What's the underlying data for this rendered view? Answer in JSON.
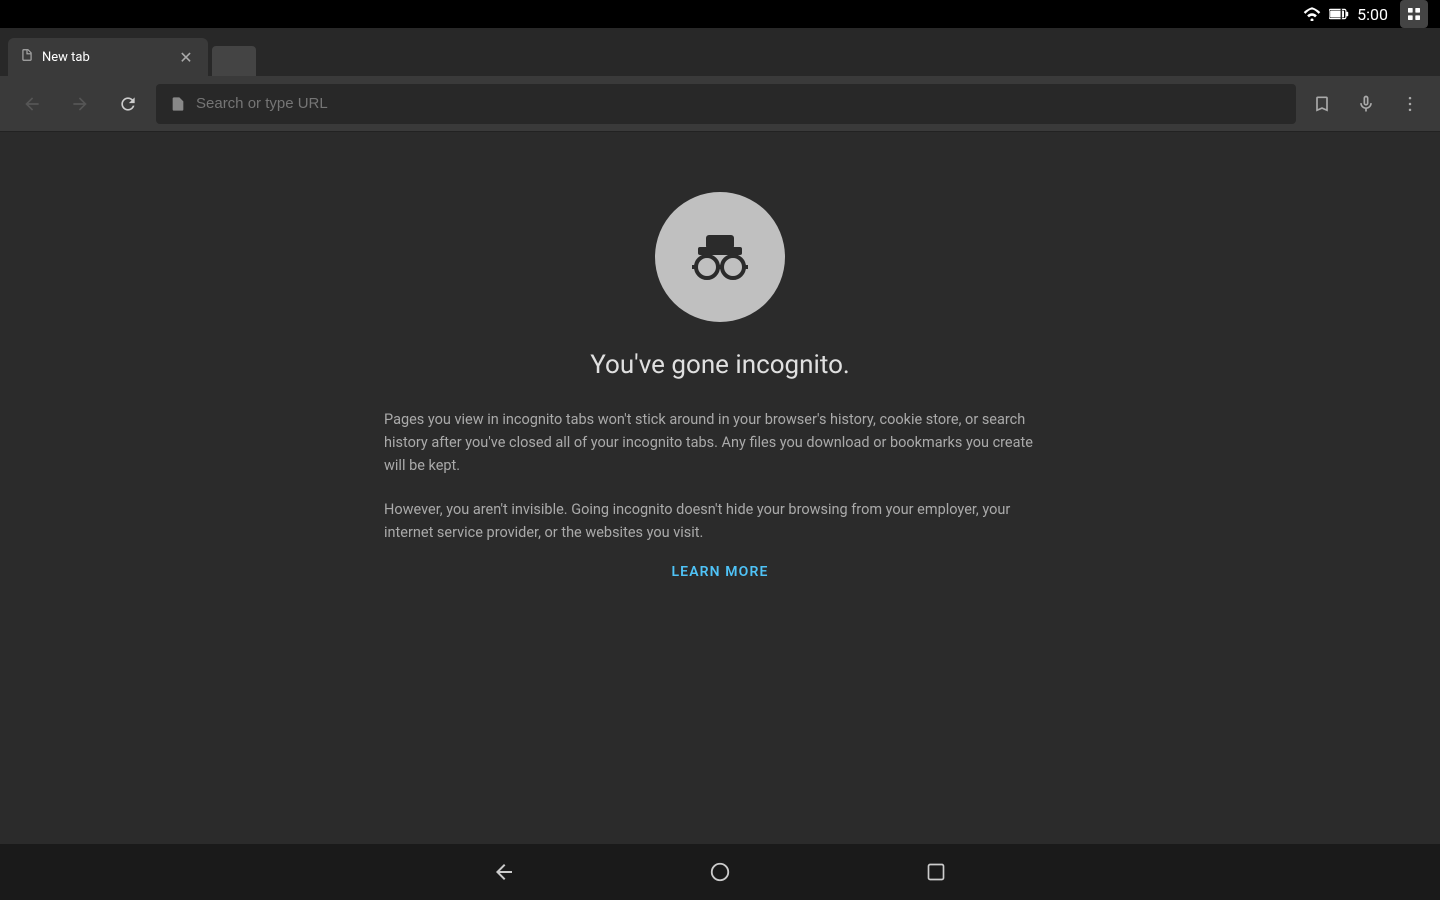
{
  "statusBar": {
    "time": "5:00",
    "wifi": "wifi",
    "battery": "battery"
  },
  "tabBar": {
    "activeTab": {
      "title": "New tab",
      "icon": "📄"
    }
  },
  "toolbar": {
    "backLabel": "←",
    "forwardLabel": "→",
    "reloadLabel": "↻",
    "addressBar": {
      "placeholder": "Search or type URL",
      "value": ""
    },
    "bookmarkLabel": "☆",
    "micLabel": "🎤",
    "menuLabel": "⋮"
  },
  "incognitoPage": {
    "title": "You've gone incognito.",
    "para1": "Pages you view in incognito tabs won't stick around in your browser's history, cookie store, or search history after you've closed all of your incognito tabs. Any files you download or bookmarks you create will be kept.",
    "para2": "However, you aren't invisible. Going incognito doesn't hide your browsing from your employer, your internet service provider, or the websites you visit.",
    "learnMoreLabel": "LEARN MORE"
  },
  "navBar": {
    "backLabel": "◁",
    "homeLabel": "○",
    "recentLabel": "□"
  }
}
